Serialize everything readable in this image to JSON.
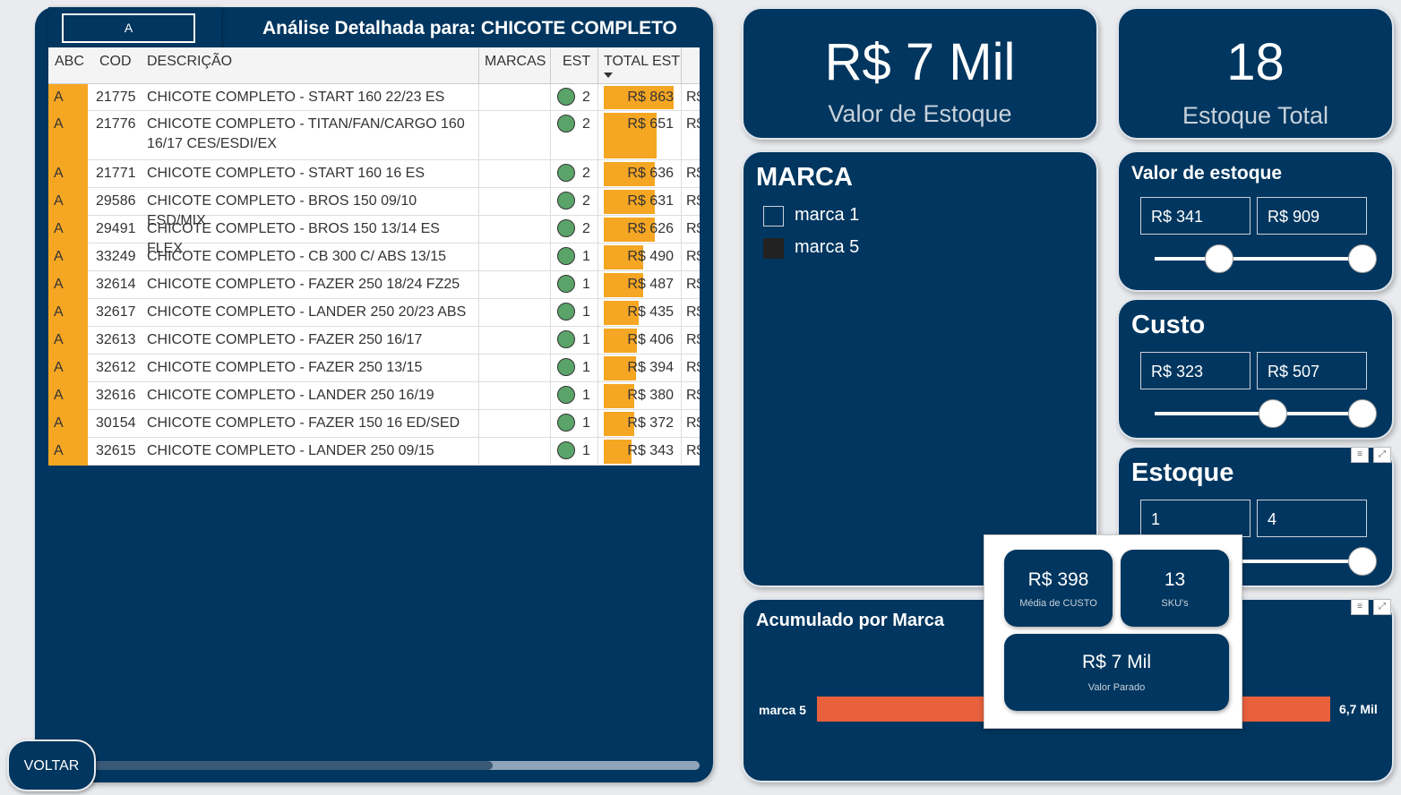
{
  "left_panel": {
    "title": "Análise Detalhada para: CHICOTE COMPLETO",
    "abc_filter": "A",
    "columns": [
      "ABC",
      "COD",
      "DESCRIÇÃO",
      "MARCAS",
      "EST",
      "TOTAL EST"
    ],
    "rows": [
      {
        "abc": "A",
        "cod": "21775",
        "desc": "CHICOTE COMPLETO - START 160 22/23 ES",
        "est": "2",
        "total": "R$ 863",
        "fill": 1.0
      },
      {
        "abc": "A",
        "cod": "21776",
        "desc": "CHICOTE COMPLETO - TITAN/FAN/CARGO 160 16/17 CES/ESDI/EX",
        "est": "2",
        "total": "R$ 651",
        "fill": 0.754
      },
      {
        "abc": "A",
        "cod": "21771",
        "desc": "CHICOTE COMPLETO - START 160 16 ES",
        "est": "2",
        "total": "R$ 636",
        "fill": 0.737
      },
      {
        "abc": "A",
        "cod": "29586",
        "desc": "CHICOTE COMPLETO - BROS 150 09/10 ESD/MIX",
        "est": "2",
        "total": "R$ 631",
        "fill": 0.731
      },
      {
        "abc": "A",
        "cod": "29491",
        "desc": "CHICOTE COMPLETO - BROS 150 13/14 ES FLEX",
        "est": "2",
        "total": "R$ 626",
        "fill": 0.725
      },
      {
        "abc": "A",
        "cod": "33249",
        "desc": "CHICOTE COMPLETO - CB 300 C/ ABS 13/15",
        "est": "1",
        "total": "R$ 490",
        "fill": 0.568
      },
      {
        "abc": "A",
        "cod": "32614",
        "desc": "CHICOTE COMPLETO - FAZER 250 18/24 FZ25",
        "est": "1",
        "total": "R$ 487",
        "fill": 0.564
      },
      {
        "abc": "A",
        "cod": "32617",
        "desc": "CHICOTE COMPLETO - LANDER 250 20/23 ABS",
        "est": "1",
        "total": "R$ 435",
        "fill": 0.504
      },
      {
        "abc": "A",
        "cod": "32613",
        "desc": "CHICOTE COMPLETO - FAZER 250 16/17",
        "est": "1",
        "total": "R$ 406",
        "fill": 0.47
      },
      {
        "abc": "A",
        "cod": "32612",
        "desc": "CHICOTE COMPLETO - FAZER 250 13/15",
        "est": "1",
        "total": "R$ 394",
        "fill": 0.457
      },
      {
        "abc": "A",
        "cod": "32616",
        "desc": "CHICOTE COMPLETO - LANDER 250 16/19",
        "est": "1",
        "total": "R$ 380",
        "fill": 0.44
      },
      {
        "abc": "A",
        "cod": "30154",
        "desc": "CHICOTE COMPLETO - FAZER 150 16 ED/SED",
        "est": "1",
        "total": "R$ 372",
        "fill": 0.431
      },
      {
        "abc": "A",
        "cod": "32615",
        "desc": "CHICOTE COMPLETO - LANDER 250 09/15",
        "est": "1",
        "total": "R$ 343",
        "fill": 0.397
      }
    ],
    "truncated_col_text": "R$"
  },
  "voltar_label": "VOLTAR",
  "kpi_valor": {
    "value": "R$ 7 Mil",
    "label": "Valor de Estoque"
  },
  "kpi_estoque": {
    "value": "18",
    "label": "Estoque Total"
  },
  "marca": {
    "title": "MARCA",
    "items": [
      {
        "label": "marca 1",
        "checked": false
      },
      {
        "label": "marca 5",
        "checked": true
      }
    ]
  },
  "slicer_valor": {
    "title": "Valor de estoque",
    "min": "R$ 341",
    "max": "R$ 909",
    "low_pos": 0.31,
    "high_pos": 1.0
  },
  "slicer_custo": {
    "title": "Custo",
    "min": "R$ 323",
    "max": "R$ 507",
    "low_pos": 0.57,
    "high_pos": 1.0
  },
  "slicer_estoque": {
    "title": "Estoque",
    "min": "1",
    "max": "4",
    "high_pos": 1.0
  },
  "acumulado": {
    "title": "Acumulado por Marca",
    "category": "marca 5",
    "value_label": "6,7 Mil"
  },
  "tooltip": {
    "media_custo": {
      "value": "R$ 398",
      "label": "Média de CUSTO"
    },
    "skus": {
      "value": "13",
      "label": "SKU's"
    },
    "valor_parado": {
      "value": "R$ 7 Mil",
      "label": "Valor Parado"
    }
  },
  "colors": {
    "navy": "#00365f",
    "orange": "#f5a623",
    "bar_red": "#e8603c",
    "dot_green": "#5aa469"
  }
}
